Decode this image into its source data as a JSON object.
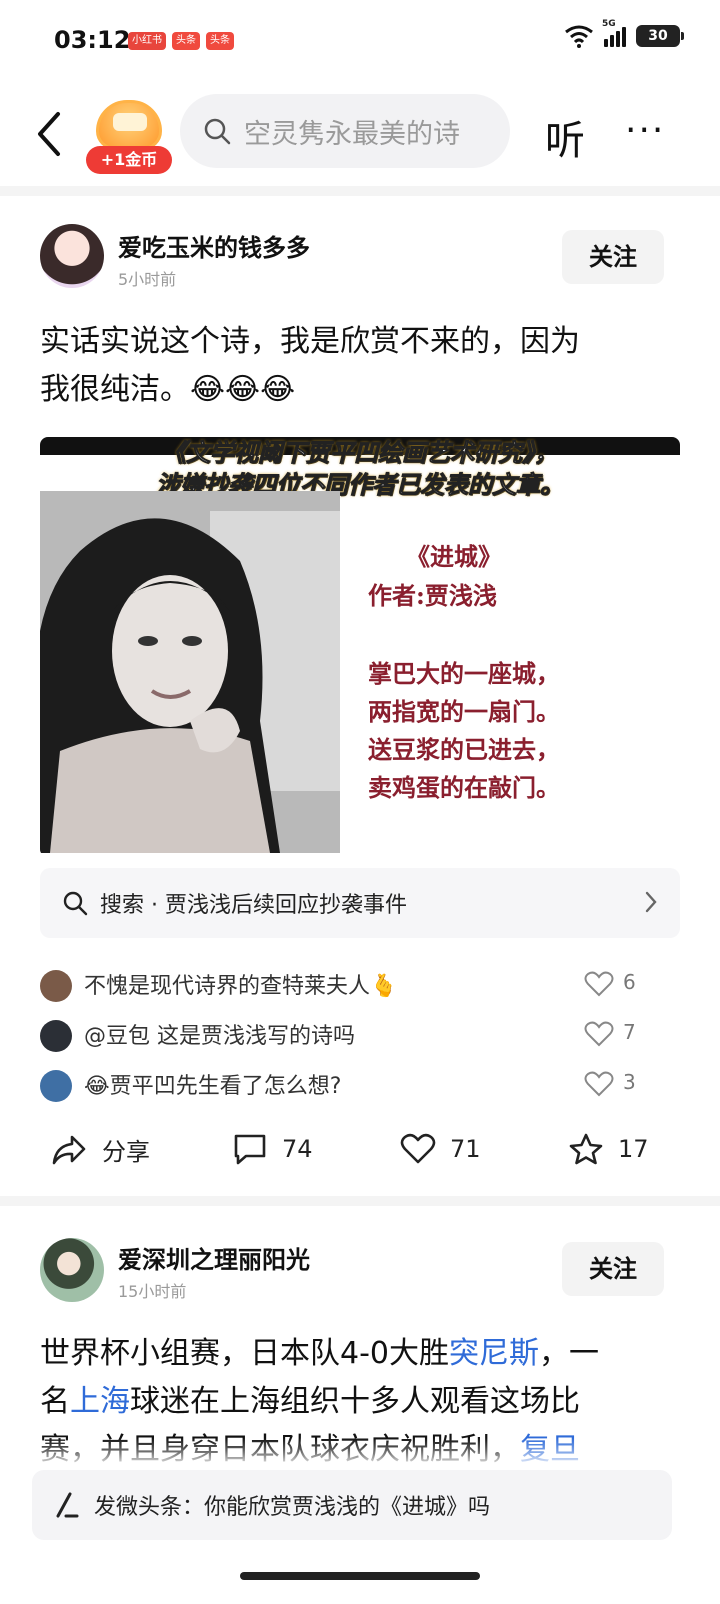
{
  "status_bar": {
    "time": "03:12",
    "badges": [
      "小红书",
      "头条",
      "头条"
    ],
    "network": "5G",
    "battery": "30"
  },
  "nav": {
    "coin_label": "+1金币",
    "search_placeholder": "空灵隽永最美的诗",
    "listen": "听",
    "more": "···"
  },
  "post1": {
    "author": "爱吃玉米的钱多多",
    "time_ago": "5小时前",
    "follow": "关注",
    "text_line1": "实话实说这个诗，我是欣赏不来的，因为",
    "text_line2": "我很纯洁。😂😂😂",
    "image": {
      "headline1": "《文学视阈下贾平凹绘画艺术研究》，",
      "headline2": "涉嫌抄袭四位不同作者已发表的文章。",
      "poem_title": "《进城》",
      "poem_author": "作者:贾浅浅",
      "poem_lines": [
        "掌巴大的一座城，",
        "两指宽的一扇门。",
        "送豆浆的已进去，",
        "卖鸡蛋的在敲门。"
      ]
    },
    "search_suggestion": "搜索 · 贾浅浅后续回应抄袭事件",
    "comments": [
      {
        "text": "不愧是现代诗界的查特莱夫人🫰",
        "likes": "6",
        "avatar_color": "#7a5a48"
      },
      {
        "text": "@豆包 这是贾浅浅写的诗吗",
        "likes": "7",
        "avatar_color": "#2b2f36"
      },
      {
        "text": "😂贾平凹先生看了怎么想?",
        "likes": "3",
        "avatar_color": "#3f6fa4"
      }
    ],
    "actions": {
      "share": "分享",
      "comments": "74",
      "likes": "71",
      "favorites": "17"
    }
  },
  "post2": {
    "author": "爱深圳之理丽阳光",
    "time_ago": "15小时前",
    "follow": "关注",
    "text_a": "世界杯小组赛，日本队4-0大胜",
    "text_link1": "突尼斯",
    "text_b": "，一",
    "text_c": "名",
    "text_link2": "上海",
    "text_d": "球迷在上海组织十多人观看这场比",
    "text_e": "赛，并且身穿日本队球衣庆祝胜利，",
    "text_link3": "复旦"
  },
  "compose": {
    "text": "发微头条：你能欣赏贾浅浅的《进城》吗"
  }
}
